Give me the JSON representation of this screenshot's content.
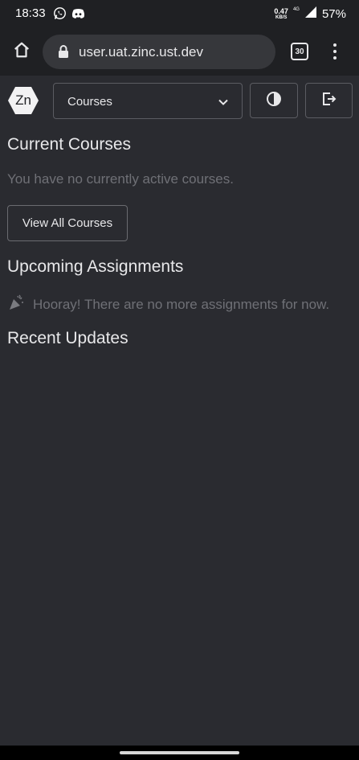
{
  "status_bar": {
    "time": "18:33",
    "net_speed_value": "0.47",
    "net_speed_unit": "KB/S",
    "network_type": "4G",
    "battery": "57%",
    "icons": [
      "whatsapp-icon",
      "discord-icon",
      "signal-icon"
    ]
  },
  "browser": {
    "url": "user.uat.zinc.ust.dev",
    "tab_count": "30",
    "icons": [
      "home-icon",
      "lock-icon",
      "overflow-menu-icon"
    ]
  },
  "header": {
    "logo_text": "Zn",
    "courses_select_value": "Courses",
    "icons": [
      "chevron-down-icon",
      "contrast-icon",
      "logout-icon"
    ]
  },
  "main": {
    "current_courses_title": "Current Courses",
    "no_courses_text": "You have no currently active courses.",
    "view_all_label": "View All Courses",
    "upcoming_title": "Upcoming Assignments",
    "hooray_text": "Hooray! There are no more assignments for now.",
    "recent_updates_title": "Recent Updates",
    "icons": [
      "party-popper-icon"
    ]
  },
  "colors": {
    "background": "#2a2b30",
    "browser_chrome": "#1f2023",
    "muted_text": "#6f7076",
    "border": "#5b5c62"
  }
}
